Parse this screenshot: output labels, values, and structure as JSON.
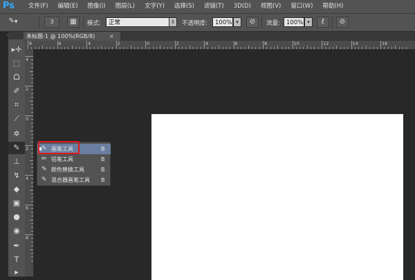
{
  "app": {
    "logo": "Ps"
  },
  "menubar": {
    "items": [
      "文件(F)",
      "编辑(E)",
      "图像(I)",
      "图层(L)",
      "文字(Y)",
      "选择(S)",
      "滤镜(T)",
      "3D(D)",
      "视图(V)",
      "窗口(W)",
      "帮助(H)"
    ]
  },
  "options_bar": {
    "brush_size": "3",
    "mode_label": "模式:",
    "mode_value": "正常",
    "opacity_label": "不透明度:",
    "opacity_value": "100%",
    "flow_label": "流量:",
    "flow_value": "100%"
  },
  "document": {
    "tab_title": "未标题-1 @ 100%(RGB/8)",
    "close_glyph": "×"
  },
  "ruler": {
    "h_labels": [
      "8",
      "6",
      "4",
      "2",
      "0",
      "2",
      "4",
      "6",
      "8",
      "10",
      "12",
      "14",
      "16"
    ],
    "v_labels": [
      "4",
      "2",
      "0",
      "2",
      "4",
      "6",
      "8"
    ]
  },
  "flyout": {
    "items": [
      {
        "label": "画笔工具",
        "key": "B",
        "icon": "brush-icon",
        "selected": true
      },
      {
        "label": "铅笔工具",
        "key": "B",
        "icon": "pencil-icon",
        "selected": false
      },
      {
        "label": "颜色替换工具",
        "key": "B",
        "icon": "color-replace-icon",
        "selected": false
      },
      {
        "label": "混合器画笔工具",
        "key": "B",
        "icon": "mixer-brush-icon",
        "selected": false
      }
    ]
  },
  "tools": [
    "move-tool",
    "marquee-tool",
    "lasso-tool",
    "quick-select-tool",
    "crop-tool",
    "eyedropper-tool",
    "healing-tool",
    "brush-tool",
    "stamp-tool",
    "history-brush-tool",
    "eraser-tool",
    "gradient-tool",
    "blur-tool",
    "dodge-tool",
    "pen-tool",
    "type-tool",
    "path-select-tool"
  ],
  "colors": {
    "accent": "#31a8ff",
    "highlight": "#6a7fa0",
    "callout": "#e0161c"
  }
}
